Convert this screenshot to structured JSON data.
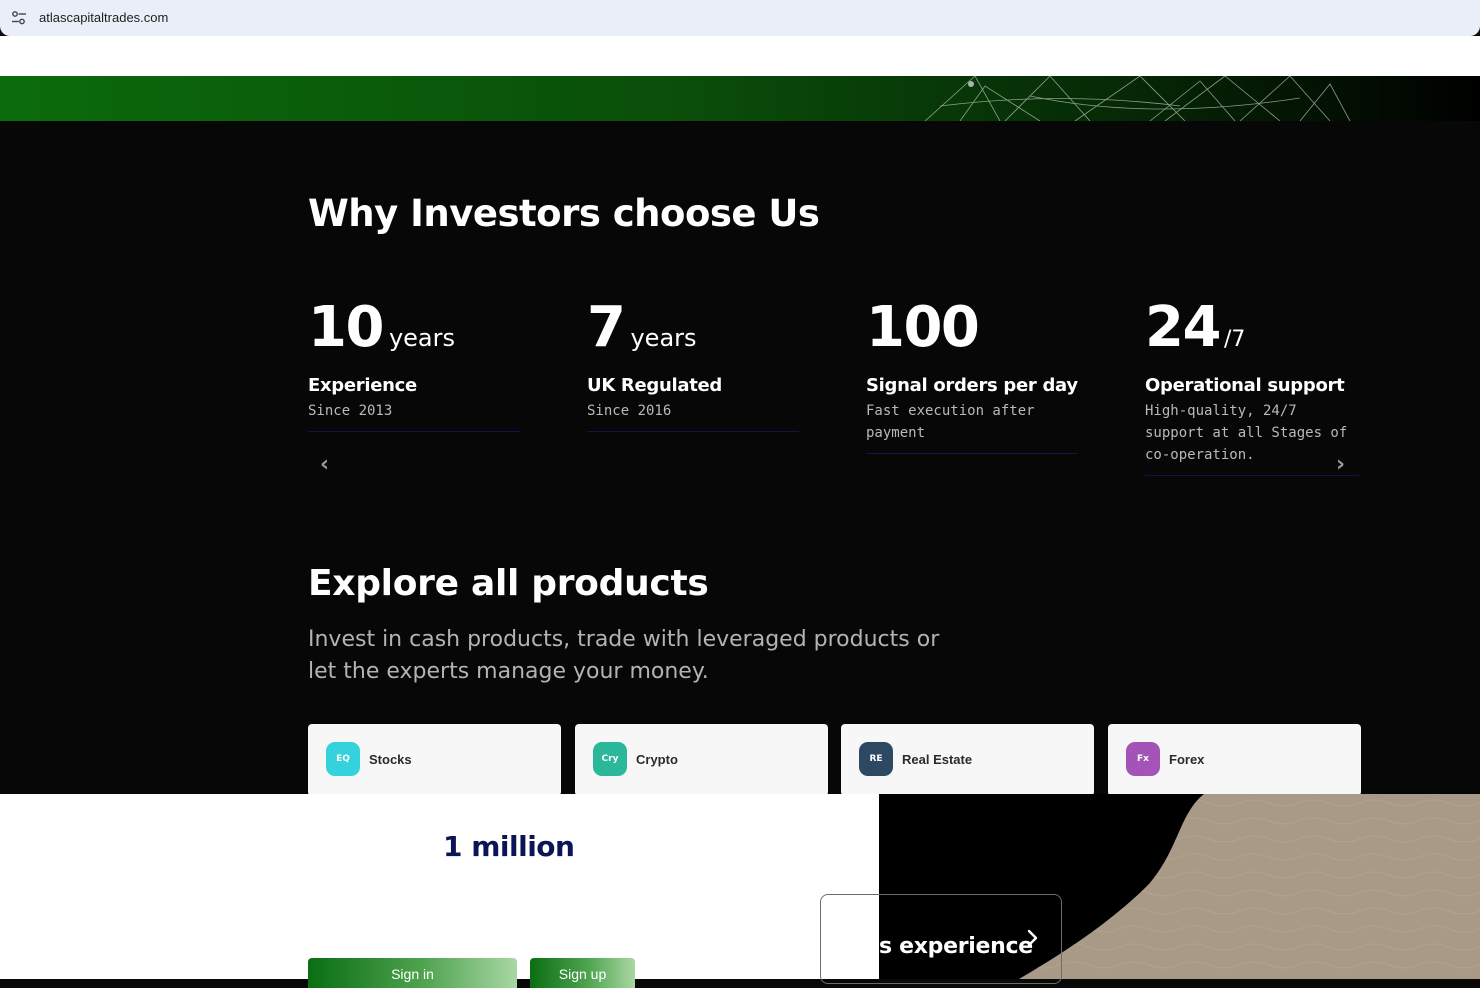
{
  "browser": {
    "url": "atlascapitaltrades.com"
  },
  "why": {
    "title": "Why Investors choose Us",
    "stats": [
      {
        "value": "10",
        "unit": "years",
        "label": "Experience",
        "sub": "Since 2013"
      },
      {
        "value": "7",
        "unit": "years",
        "label": "UK Regulated",
        "sub": "Since 2016"
      },
      {
        "value": "100",
        "unit": "",
        "label": "Signal orders per day",
        "sub": "Fast execution after payment"
      },
      {
        "value": "24",
        "unit": "/7",
        "label": "Operational support",
        "sub": "High-quality, 24/7 support at all Stages of co-operation."
      }
    ],
    "prev_arrow": "‹",
    "next_arrow": "›"
  },
  "explore": {
    "title": "Explore all products",
    "lede": "Invest in cash products, trade with leveraged products or let the experts manage your money.",
    "products": [
      {
        "badge": "EQ",
        "name": "Stocks",
        "color": "#33d2dc"
      },
      {
        "badge": "Cry",
        "name": "Crypto",
        "color": "#2bb89a"
      },
      {
        "badge": "RE",
        "name": "Real Estate",
        "color": "#2d4863"
      },
      {
        "badge": "Fx",
        "name": "Forex",
        "color": "#a454b9"
      }
    ]
  },
  "bottom": {
    "million": "1 million",
    "sign_in": "Sign in",
    "sign_up": "Sign up",
    "experience_text": "s experience"
  }
}
